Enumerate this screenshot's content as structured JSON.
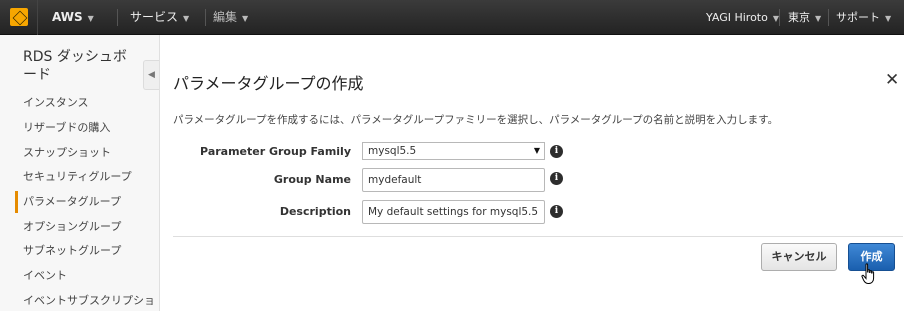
{
  "topbar": {
    "brand": "AWS",
    "services": "サービス",
    "edit": "編集",
    "user": "YAGI Hiroto",
    "region": "東京",
    "support": "サポート"
  },
  "sidebar": {
    "title": "RDS ダッシュボード",
    "items": [
      {
        "label": "インスタンス"
      },
      {
        "label": "リザーブドの購入"
      },
      {
        "label": "スナップショット"
      },
      {
        "label": "セキュリティグループ"
      },
      {
        "label": "パラメータグループ",
        "active": true
      },
      {
        "label": "オプショングループ"
      },
      {
        "label": "サブネットグループ"
      },
      {
        "label": "イベント"
      },
      {
        "label": "イベントサブスクリプショ"
      }
    ]
  },
  "dialog": {
    "title": "パラメータグループの作成",
    "description": "パラメータグループを作成するには、パラメータグループファミリーを選択し、パラメータグループの名前と説明を入力します。",
    "fields": {
      "family": {
        "label": "Parameter Group Family",
        "value": "mysql5.5"
      },
      "name": {
        "label": "Group Name",
        "value": "mydefault"
      },
      "description": {
        "label": "Description",
        "value": "My default settings for mysql5.5"
      }
    },
    "cancel_label": "キャンセル",
    "create_label": "作成"
  },
  "colors": {
    "topbar_bg": "#2b2b2b",
    "accent_orange": "#e58b00",
    "primary_blue": "#1a5fae"
  }
}
